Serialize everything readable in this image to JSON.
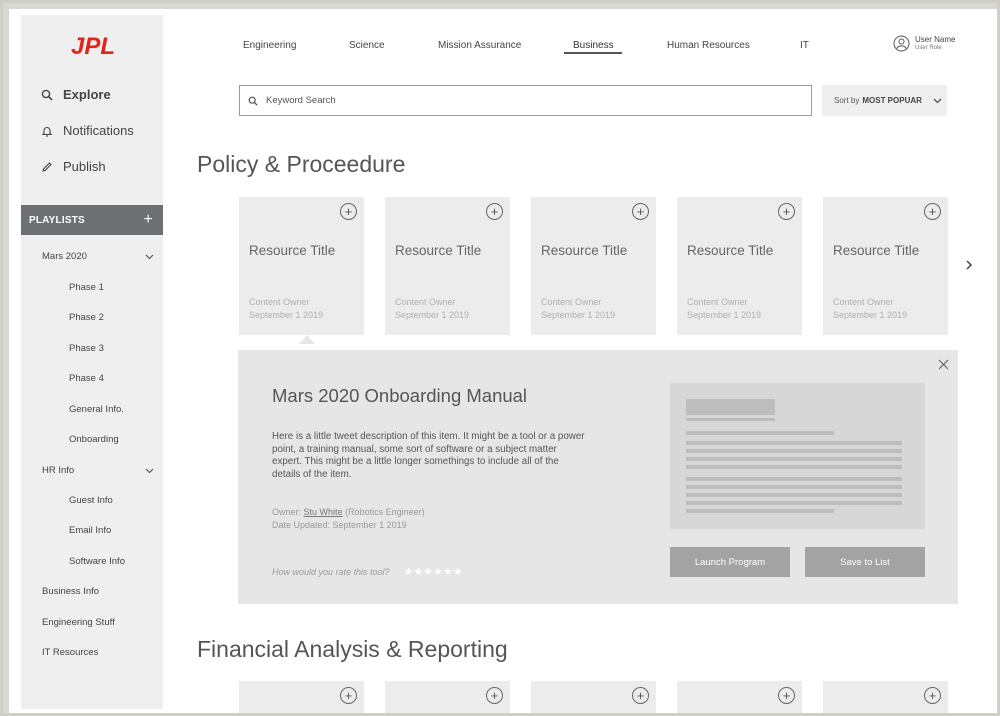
{
  "brand": {
    "logo_text": "JPL",
    "color": "#e1251b"
  },
  "sidebar": {
    "links": [
      {
        "label": "Explore",
        "icon": "search-icon"
      },
      {
        "label": "Notifications",
        "icon": "bell-icon"
      },
      {
        "label": "Publish",
        "icon": "pencil-icon"
      }
    ],
    "playlists_label": "PLAYLISTS",
    "groups": [
      {
        "label": "Mars 2020",
        "expanded": true,
        "items": [
          "Phase 1",
          "Phase 2",
          "Phase 3",
          "Phase 4",
          "General Info.",
          "Onboarding"
        ]
      },
      {
        "label": "HR Info",
        "expanded": true,
        "items": [
          "Guest Info",
          "Email Info",
          "Software Info"
        ]
      },
      {
        "label": "Business Info"
      },
      {
        "label": "Engineering Stuff"
      },
      {
        "label": "IT Resources"
      }
    ]
  },
  "topnav": {
    "items": [
      "Engineering",
      "Science",
      "Mission Assurance",
      "Business",
      "Human Resources",
      "IT"
    ],
    "active": "Business"
  },
  "user": {
    "name": "User Name",
    "role": "User Role"
  },
  "search": {
    "placeholder": "Keyword Search"
  },
  "sort": {
    "prefix": "Sort by",
    "value": "MOST POPUAR"
  },
  "sections": [
    {
      "title": "Policy & Proceedure",
      "cards": [
        {
          "title": "Resource Title",
          "owner": "Content Owner",
          "date": "September 1 2019"
        },
        {
          "title": "Resource Title",
          "owner": "Content Owner",
          "date": "September 1 2019"
        },
        {
          "title": "Resource Title",
          "owner": "Content Owner",
          "date": "September 1 2019"
        },
        {
          "title": "Resource Title",
          "owner": "Content Owner",
          "date": "September 1 2019"
        },
        {
          "title": "Resource Title",
          "owner": "Content Owner",
          "date": "September 1 2019"
        }
      ]
    },
    {
      "title": "Financial Analysis & Reporting"
    }
  ],
  "detail": {
    "title": "Mars 2020 Onboarding Manual",
    "description": "Here is a little tweet description of this item. It might be a tool or a power point, a training manual, some sort of software or a subject matter expert. This might be a little longer somethings to include all of the details of the item.",
    "owner_label": "Owner:",
    "owner_name": "Stu White",
    "owner_role": "(Robotics Engineer)",
    "date_updated": "Date Updated: September 1 2019",
    "rate_prompt": "How would you rate this tool?",
    "stars": "★★★★★★",
    "launch_label": "Launch Program",
    "save_label": "Save to List"
  }
}
